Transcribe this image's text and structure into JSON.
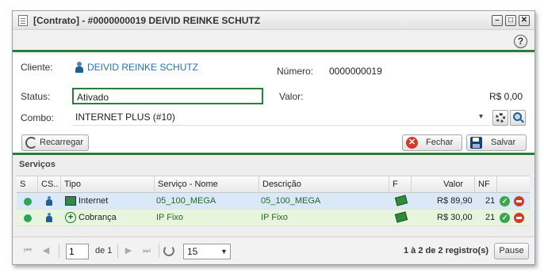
{
  "window": {
    "title": "[Contrato] - #0000000019 DEIVID REINKE SCHUTZ",
    "minimize_glyph": "–",
    "maximize_glyph": "□",
    "close_glyph": "✕"
  },
  "toolbar": {
    "help_glyph": "?"
  },
  "form": {
    "cliente_label": "Cliente:",
    "cliente_value": "DEIVID REINKE SCHUTZ",
    "numero_label": "Número:",
    "numero_value": "0000000019",
    "status_label": "Status:",
    "status_value": "Ativado",
    "valor_label": "Valor:",
    "valor_value": "R$ 0,00",
    "combo_label": "Combo:",
    "combo_value": "INTERNET PLUS (#10)",
    "combo_arrow": "▾"
  },
  "actions": {
    "recarregar_label": "Recarregar",
    "fechar_label": "Fechar",
    "salvar_label": "Salvar",
    "cancel_glyph": "✕"
  },
  "servicos": {
    "section_title": "Serviços",
    "columns": [
      "S",
      "CS..",
      "Tipo",
      "Serviço - Nome",
      "Descrição",
      "F",
      "Valor",
      "NF"
    ],
    "rows": [
      {
        "tipo": "Internet",
        "servico_nome": "05_100_MEGA",
        "descricao": "05_100_MEGA",
        "valor": "R$ 89,90",
        "nf": "21",
        "status_color": "#2aa55a"
      },
      {
        "tipo": "Cobrança",
        "servico_nome": "IP Fixo",
        "descricao": "IP Fixo",
        "valor": "R$ 30,00",
        "nf": "21",
        "status_color": "#2aa55a"
      }
    ],
    "ok_glyph": "✓",
    "plus_glyph": "+"
  },
  "pager": {
    "first_glyph": "⏮",
    "prev_glyph": "◀",
    "next_glyph": "▶",
    "last_glyph": "⏭",
    "page_value": "1",
    "page_of": "de 1",
    "page_size": "15",
    "size_arrow": "▼",
    "count_text": "1 à 2 de 2 registro(s)",
    "pause_label": "Pause"
  },
  "colors": {
    "accent_green": "#2a7d3a",
    "row_internet": "#dbe8f7",
    "row_cobranca": "#e6f5dc",
    "link_blue": "#2a6fb0"
  }
}
